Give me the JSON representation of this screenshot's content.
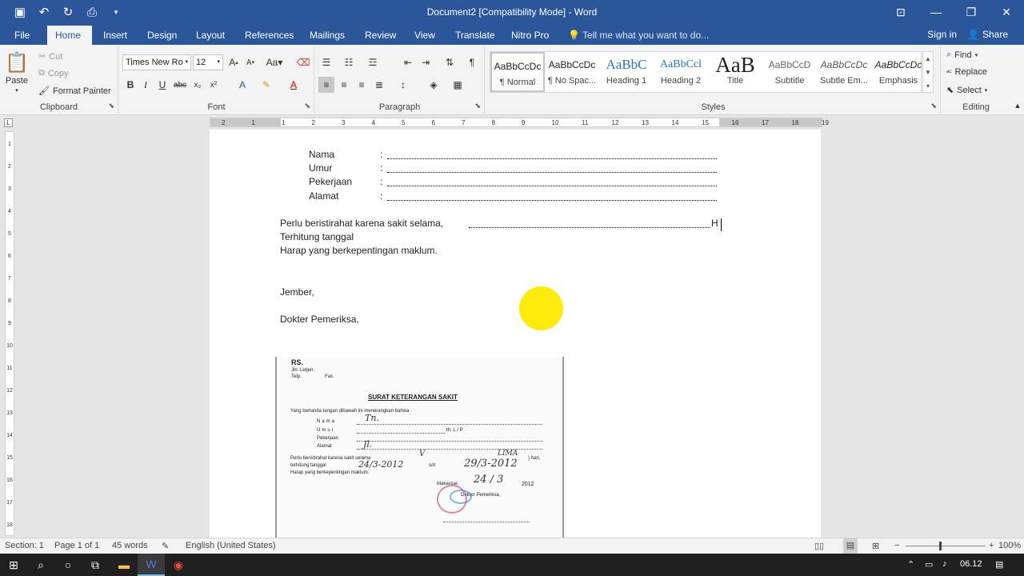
{
  "title": "Document2 [Compatibility Mode] - Word",
  "tabs": [
    "File",
    "Home",
    "Insert",
    "Design",
    "Layout",
    "References",
    "Mailings",
    "Review",
    "View",
    "Translate",
    "Nitro Pro"
  ],
  "tell_me": "Tell me what you want to do...",
  "signin": "Sign in",
  "share": "Share",
  "clipboard": {
    "label": "Clipboard",
    "paste": "Paste",
    "cut": "Cut",
    "copy": "Copy",
    "format_painter": "Format Painter"
  },
  "font": {
    "label": "Font",
    "name": "Times New Ro",
    "size": "12"
  },
  "paragraph": {
    "label": "Paragraph"
  },
  "styles": {
    "label": "Styles",
    "items": [
      {
        "preview": "AaBbCcDc",
        "name": "¶ Normal"
      },
      {
        "preview": "AaBbCcDc",
        "name": "¶ No Spac..."
      },
      {
        "preview": "AaBbC",
        "name": "Heading 1"
      },
      {
        "preview": "AaBbCcl",
        "name": "Heading 2"
      },
      {
        "preview": "AaB",
        "name": "Title"
      },
      {
        "preview": "AaBbCcD",
        "name": "Subtitle"
      },
      {
        "preview": "AaBbCcDc",
        "name": "Subtle Em..."
      },
      {
        "preview": "AaBbCcDc",
        "name": "Emphasis"
      }
    ]
  },
  "editing": {
    "label": "Editing",
    "find": "Find",
    "replace": "Replace",
    "select": "Select"
  },
  "ruler": {
    "h": [
      "2",
      "1",
      "1",
      "2",
      "3",
      "4",
      "5",
      "6",
      "7",
      "8",
      "9",
      "10",
      "11",
      "12",
      "13",
      "14",
      "15",
      "16",
      "17",
      "18",
      "19"
    ],
    "v": [
      "1",
      "2",
      "3",
      "4",
      "5",
      "6",
      "7",
      "8",
      "9",
      "10",
      "11",
      "12",
      "13",
      "14",
      "15",
      "16",
      "17",
      "18"
    ]
  },
  "doc": {
    "fields": [
      {
        "label": "Nama",
        "colon": ":"
      },
      {
        "label": "Umur",
        "colon": ":"
      },
      {
        "label": "Pekerjaan",
        "colon": ":"
      },
      {
        "label": "Alamat",
        "colon": ":"
      }
    ],
    "line1": "Perlu beristirahat karena sakit selama,",
    "line1_end": "H",
    "line2": "Terhitung tanggal",
    "line3": "Harap yang berkepentingan maklum.",
    "city": "Jember,",
    "doctor": "Dokter Pemeriksa,"
  },
  "scan": {
    "rs": "RS.",
    "addr": "Jln. Letjen.",
    "tel": "Telp.",
    "fax": "Fax.",
    "title": "SURAT KETERANGAN SAKIT",
    "intro": "Yang bertanda tangan dibawah ini menerangkan bahwa :",
    "nama": "Nama",
    "umur": "Umur",
    "pekerjaan": "Pekerjaan",
    "alamat": "Alamat",
    "th": "th; L / P",
    "p1": "Perlu beristirahat karena sakit selama",
    "hari": ") hari,",
    "p2": "terhitung tanggal",
    "sd": "s/d",
    "p3": "Harap yang berkepentingan maklum.",
    "city": "Makassar,",
    "year": "2012",
    "doctor": "Dokter Pemeriksa,",
    "hw_name": "Tn.",
    "hw_alamat": "Jl.",
    "hw_v": "V",
    "hw_lima": "LIMA",
    "hw_date1": "24/3-2012",
    "hw_date2": "29/3-2012",
    "hw_date3": "24 / 3"
  },
  "status": {
    "section": "Section: 1",
    "page": "Page 1 of 1",
    "words": "45 words",
    "lang": "English (United States)",
    "zoom": "100%"
  },
  "clock": "06.12"
}
